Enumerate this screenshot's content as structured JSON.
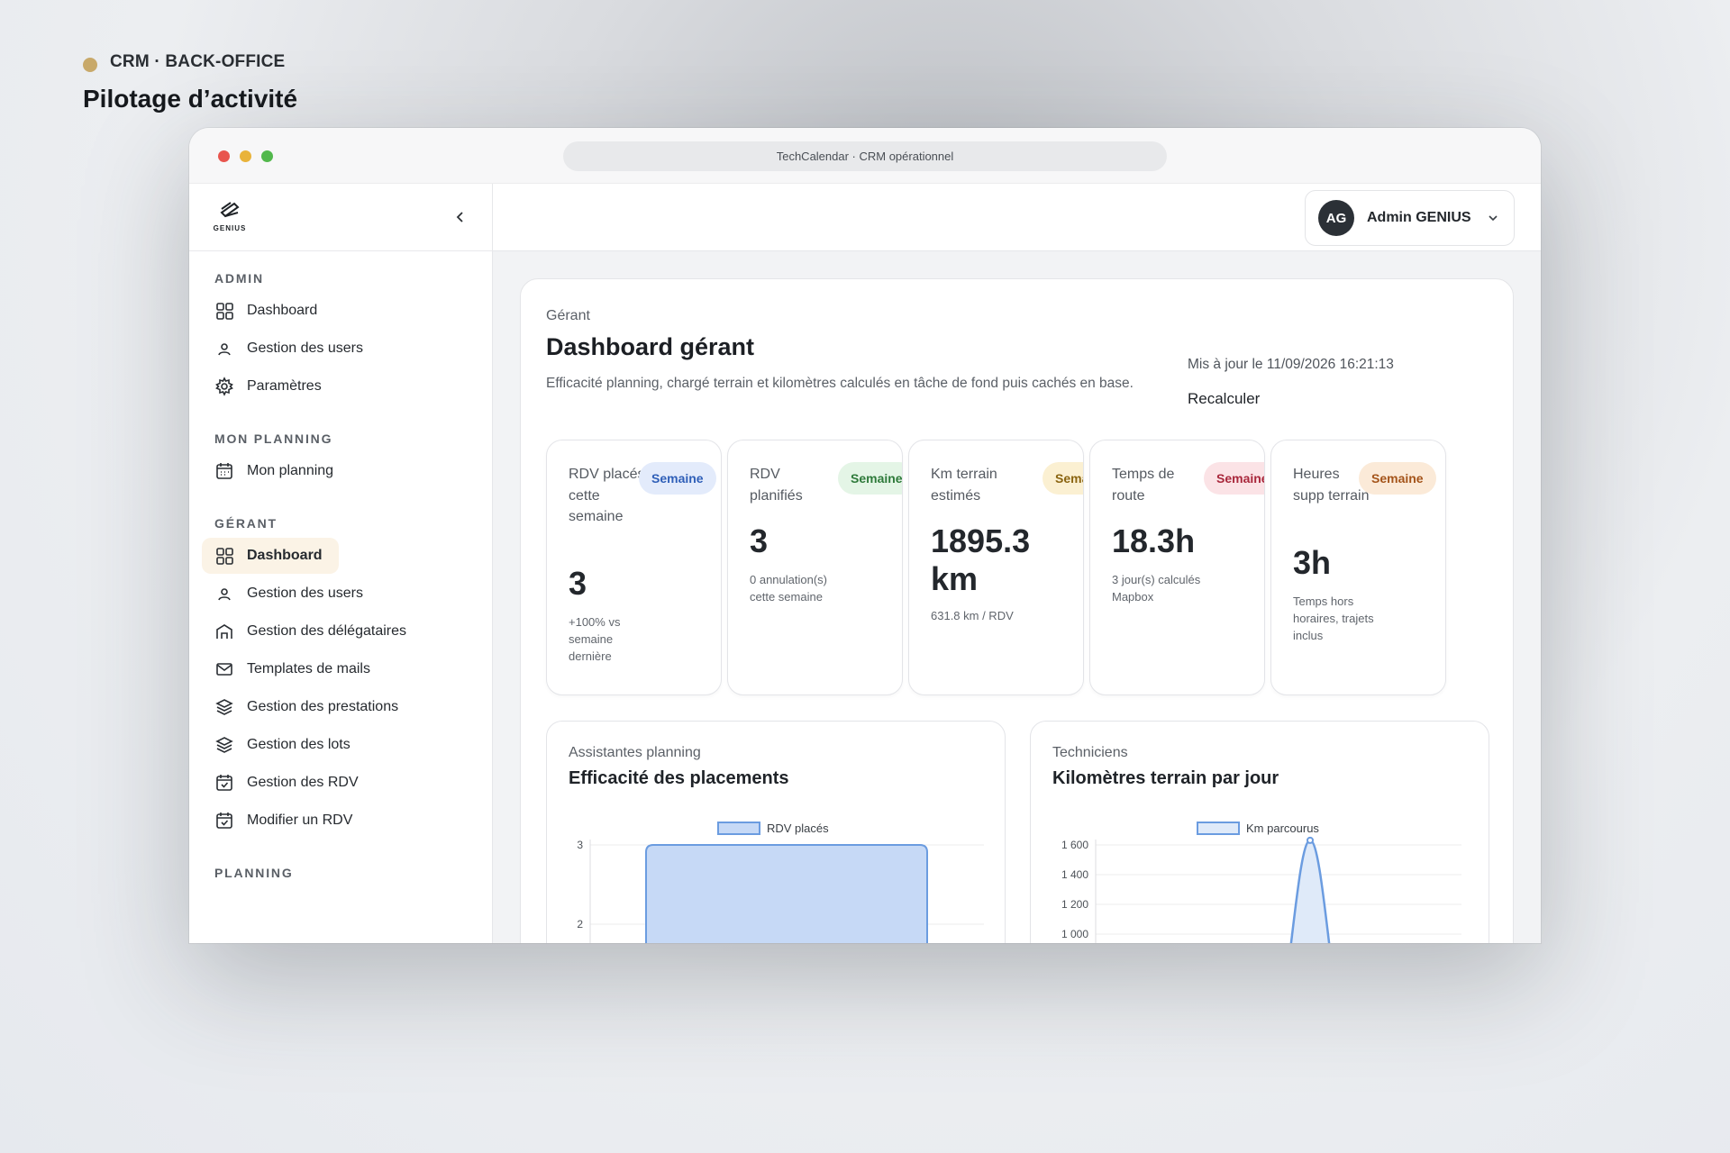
{
  "page": {
    "eyebrow": "CRM · BACK-OFFICE",
    "title": "Pilotage d’activité"
  },
  "browser": {
    "url": "TechCalendar · CRM opérationnel"
  },
  "logo": {
    "word": "GENIUS"
  },
  "sidebar": {
    "sections": [
      {
        "label": "ADMIN",
        "items": [
          {
            "label": "Dashboard",
            "icon": "grid-icon"
          },
          {
            "label": "Gestion des users",
            "icon": "user-icon"
          },
          {
            "label": "Paramètres",
            "icon": "gear-icon"
          }
        ]
      },
      {
        "label": "MON PLANNING",
        "items": [
          {
            "label": "Mon planning",
            "icon": "calendar-icon"
          }
        ]
      },
      {
        "label": "GÉRANT",
        "items": [
          {
            "label": "Dashboard",
            "icon": "grid-icon"
          },
          {
            "label": "Gestion des users",
            "icon": "user-icon"
          },
          {
            "label": "Gestion des délégataires",
            "icon": "building-icon"
          },
          {
            "label": "Templates de mails",
            "icon": "mail-icon"
          },
          {
            "label": "Gestion des prestations",
            "icon": "layers-icon"
          },
          {
            "label": "Gestion des lots",
            "icon": "layers-icon"
          },
          {
            "label": "Gestion des RDV",
            "icon": "calendar-check-icon"
          },
          {
            "label": "Modifier un RDV",
            "icon": "calendar-check-icon"
          }
        ]
      },
      {
        "label": "PLANNING",
        "items": []
      }
    ]
  },
  "user": {
    "initials": "AG",
    "name": "Admin GENIUS"
  },
  "dashboard": {
    "crumb": "Gérant",
    "title": "Dashboard gérant",
    "description": "Efficacité planning, chargé terrain et kilomètres calculés en tâche de fond puis cachés en base.",
    "updated": "Mis à jour le 11/09/2026 16:21:13",
    "recalc": "Recalculer"
  },
  "kpis": [
    {
      "label": "RDV placés cette semaine",
      "badge": "Semaine",
      "value": "3",
      "sub": "+100% vs semaine dernière",
      "badge_bg": "#e3ebfb",
      "badge_fg": "#2f5fb8"
    },
    {
      "label": "RDV planifiés",
      "badge": "Semaine",
      "value": "3",
      "sub": "0 annulation(s) cette semaine",
      "badge_bg": "#e4f5e6",
      "badge_fg": "#2e7a3a"
    },
    {
      "label": "Km terrain estimés",
      "badge": "Semaine",
      "value": "1895.3 km",
      "sub": "631.8 km / RDV",
      "badge_bg": "#fbf0d2",
      "badge_fg": "#8a6410"
    },
    {
      "label": "Temps de route",
      "badge": "Semaine",
      "value": "18.3h",
      "sub": "3 jour(s) calculés Mapbox",
      "badge_bg": "#fbe3e6",
      "badge_fg": "#a9283c"
    },
    {
      "label": "Heures supp terrain",
      "badge": "Semaine",
      "value": "3h",
      "sub": "Temps hors horaires, trajets inclus",
      "badge_bg": "#fbead8",
      "badge_fg": "#a4541a"
    }
  ],
  "panels": {
    "left": {
      "eyebrow": "Assistantes planning",
      "title": "Efficacité des placements"
    },
    "right": {
      "eyebrow": "Techniciens",
      "title": "Kilomètres terrain par jour"
    }
  },
  "chart_data": [
    {
      "type": "bar",
      "series": [
        {
          "name": "RDV placés",
          "values": [
            3
          ]
        }
      ],
      "yticks": [
        "3",
        "2"
      ],
      "ylim": [
        0,
        3
      ],
      "legend": "top",
      "color": "#c6d9f6",
      "stroke": "#6b9ce0"
    },
    {
      "type": "area",
      "series": [
        {
          "name": "Km parcourus",
          "values": [
            0,
            0,
            1631,
            0,
            0
          ]
        }
      ],
      "yticks": [
        "1 600",
        "1 400",
        "1 200",
        "1 000"
      ],
      "ylim": [
        0,
        1600
      ],
      "legend": "top",
      "color": "#dfeaf9",
      "stroke": "#6b9ce0"
    }
  ]
}
